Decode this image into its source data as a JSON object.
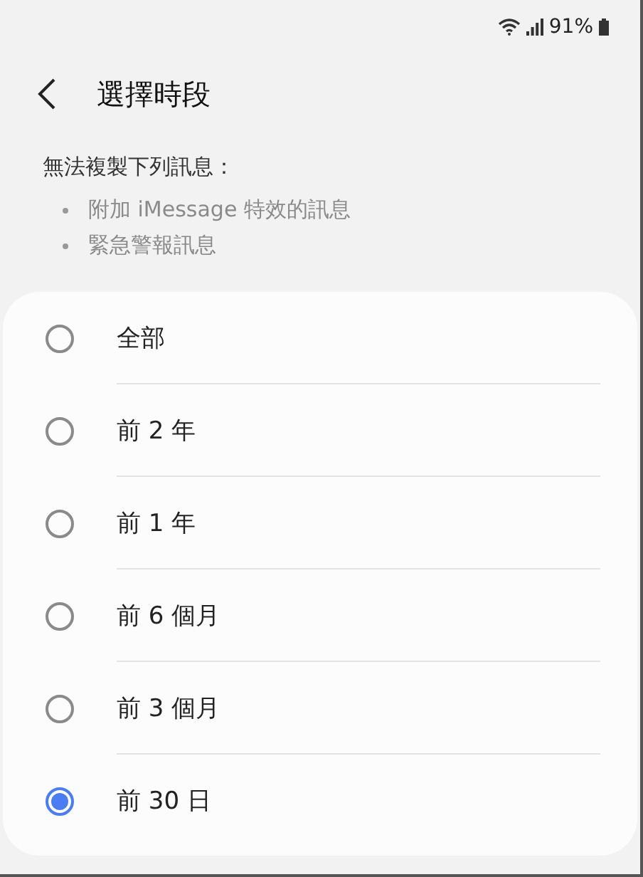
{
  "status_bar": {
    "battery": "91%"
  },
  "header": {
    "title": "選擇時段"
  },
  "notice": {
    "text": "無法複製下列訊息：",
    "items": [
      "附加 iMessage 特效的訊息",
      "緊急警報訊息"
    ]
  },
  "options": [
    {
      "label": "全部",
      "selected": false
    },
    {
      "label": "前 2 年",
      "selected": false
    },
    {
      "label": "前 1 年",
      "selected": false
    },
    {
      "label": "前 6 個月",
      "selected": false
    },
    {
      "label": "前 3 個月",
      "selected": false
    },
    {
      "label": "前 30 日",
      "selected": true
    }
  ]
}
